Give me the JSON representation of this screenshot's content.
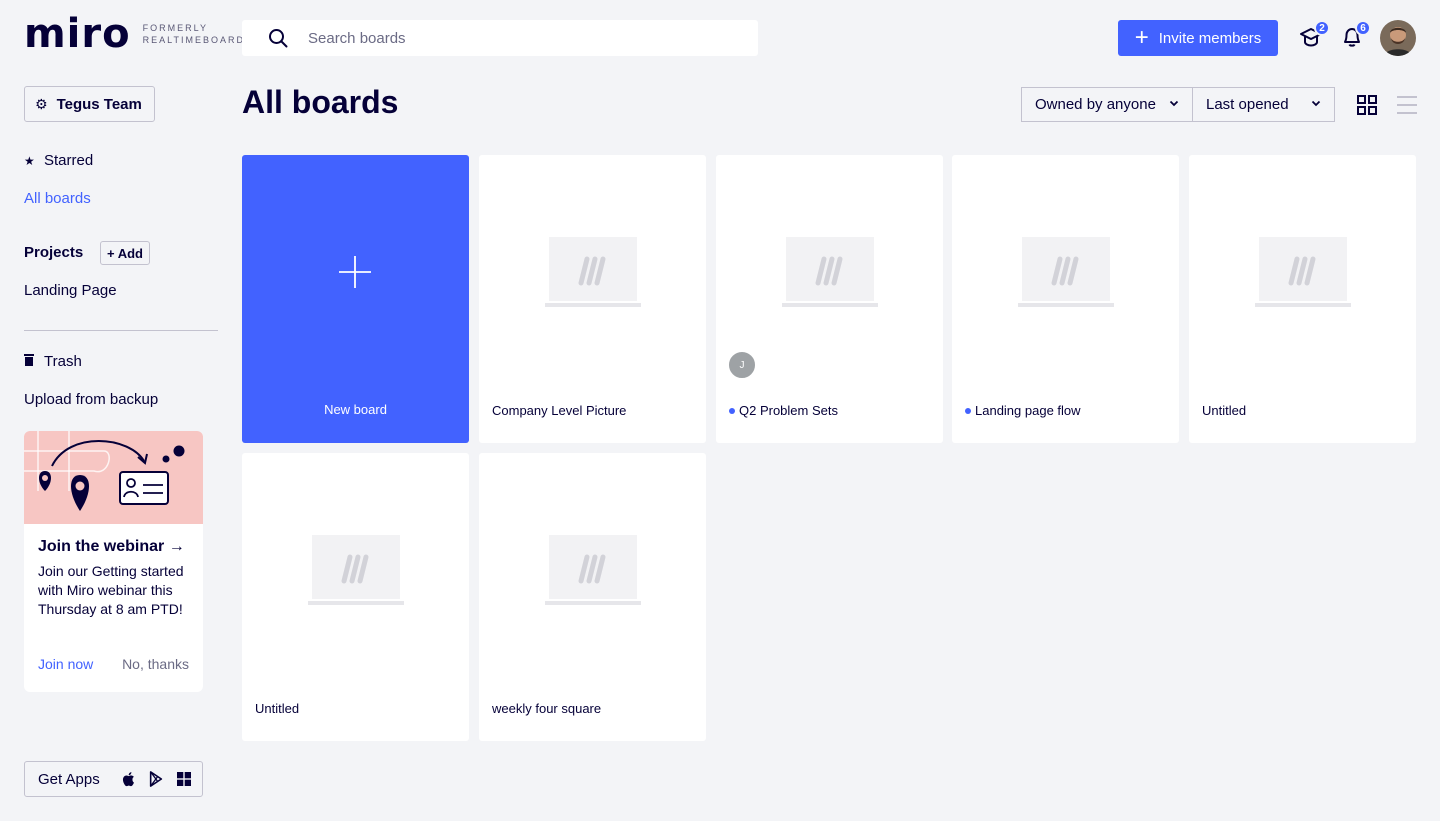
{
  "brand": {
    "name": "miro",
    "tagline_line1": "FORMERLY",
    "tagline_line2": "REALTIMEBOARD"
  },
  "search": {
    "placeholder": "Search boards"
  },
  "header": {
    "invite_label": "Invite members",
    "learning_badge": "2",
    "notifications_badge": "6",
    "accent": "#4262ff"
  },
  "sidebar": {
    "team": "Tegus Team",
    "starred": "Starred",
    "all_boards": "All boards",
    "projects_title": "Projects",
    "add_label": "+ Add",
    "project_items": [
      "Landing Page"
    ],
    "trash": "Trash",
    "upload": "Upload from backup",
    "promo": {
      "title": "Join the webinar →",
      "text": "Join our Getting started with Miro webinar this Thursday at 8 am PTD!",
      "join": "Join now",
      "dismiss": "No, thanks"
    },
    "get_apps": "Get Apps"
  },
  "main": {
    "title": "All boards",
    "owner_filter": "Owned by anyone",
    "sort_filter": "Last opened",
    "new_board": "New board",
    "boards": [
      {
        "name": "Company Level Picture"
      },
      {
        "name": "Q2 Problem Sets",
        "initial": "J"
      },
      {
        "name": "Landing page flow"
      },
      {
        "name": "Untitled"
      },
      {
        "name": "Untitled"
      },
      {
        "name": "weekly four square"
      }
    ]
  }
}
